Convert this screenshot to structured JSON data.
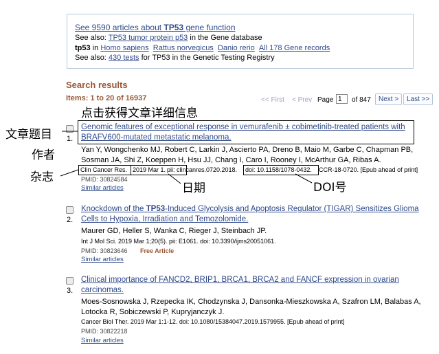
{
  "gene_box": {
    "line1_prefix": "See 9590 articles about ",
    "line1_gene": "TP53",
    "line1_suffix": " gene function",
    "line2_prefix": "See also: ",
    "line2_link": "TP53 tumor protein p53",
    "line2_suffix": " in the Gene database",
    "line3_label": "tp53",
    "line3_in": " in ",
    "species": [
      "Homo sapiens",
      "Rattus norvegicus",
      "Danio rerio"
    ],
    "all_records": "All 178 Gene records",
    "line4_prefix": "See also: ",
    "line4_link": "430 tests",
    "line4_suffix": " for TP53 in the Genetic Testing Registry"
  },
  "results": {
    "heading": "Search results",
    "items_count": "Items: 1 to 20 of 16937"
  },
  "pager": {
    "first": "<< First",
    "prev": "< Prev",
    "page_label": "Page",
    "page_value": "1",
    "of_pages": "of 847",
    "next": "Next >",
    "last": "Last >>"
  },
  "annotations": {
    "click_detail": "点击获得文章详细信息",
    "title_label": "文章题目",
    "author_label": "作者",
    "journal_label": "杂志",
    "date_label": "日期",
    "doi_label": "DOI号"
  },
  "articles": [
    {
      "number": "1.",
      "title_line1": "Genomic features of exceptional response in vemurafenib ± cobimetinib-treated patients with",
      "title_line2": "BRAFV600-mutated metastatic melanoma.",
      "authors_line1": "Yan Y, Wongchenko MJ, Robert C, Larkin J, Ascierto PA, Dreno B, Maio M, Garbe C, Chapman PB,",
      "authors_line2": "Sosman JA, Shi Z, Koeppen H, Hsu JJ, Chang I, Caro I, Rooney I, McArthur GA, Ribas A.",
      "journal": "Clin Cancer Res.",
      "date": "2019 Mar 1.",
      "pii": "pii: clincanres.0720.2018.",
      "doi": "doi: 10.1158/1078-0432.",
      "cite_rest": "CCR-18-0720. [Epub ahead of print]",
      "pmid": "PMID: 30824584",
      "similar": "Similar articles"
    },
    {
      "number": "2.",
      "title_line1_pre": "Knockdown of the ",
      "title_line1_gene": "TP53",
      "title_line1_post": "-Induced Glycolysis and Apoptosis Regulator (TIGAR) Sensitizes Glioma",
      "title_line2": "Cells to Hypoxia, Irradiation and Temozolomide.",
      "authors_line1": "Maurer GD, Heller S, Wanka C, Rieger J, Steinbach JP.",
      "citation": "Int J Mol Sci. 2019 Mar 1;20(5). pii: E1061. doi: 10.3390/ijms20051061.",
      "pmid": "PMID: 30823646",
      "free": "Free Article",
      "similar": "Similar articles"
    },
    {
      "number": "3.",
      "title_line1": "Clinical importance of FANCD2, BRIP1, BRCA1, BRCA2 and FANCF expression in ovarian",
      "title_line2": "carcinomas.",
      "authors_line1": "Moes-Sosnowska J, Rzepecka IK, Chodzynska J, Dansonka-Mieszkowska A, Szafron LM, Balabas A,",
      "authors_line2": "Lotocka R, Sobiczewski P, Kupryjanczyk J.",
      "citation": "Cancer Biol Ther. 2019 Mar 1:1-12. doi: 10.1080/15384047.2019.1579955. [Epub ahead of print]",
      "pmid": "PMID: 30822218",
      "similar": "Similar articles"
    }
  ]
}
